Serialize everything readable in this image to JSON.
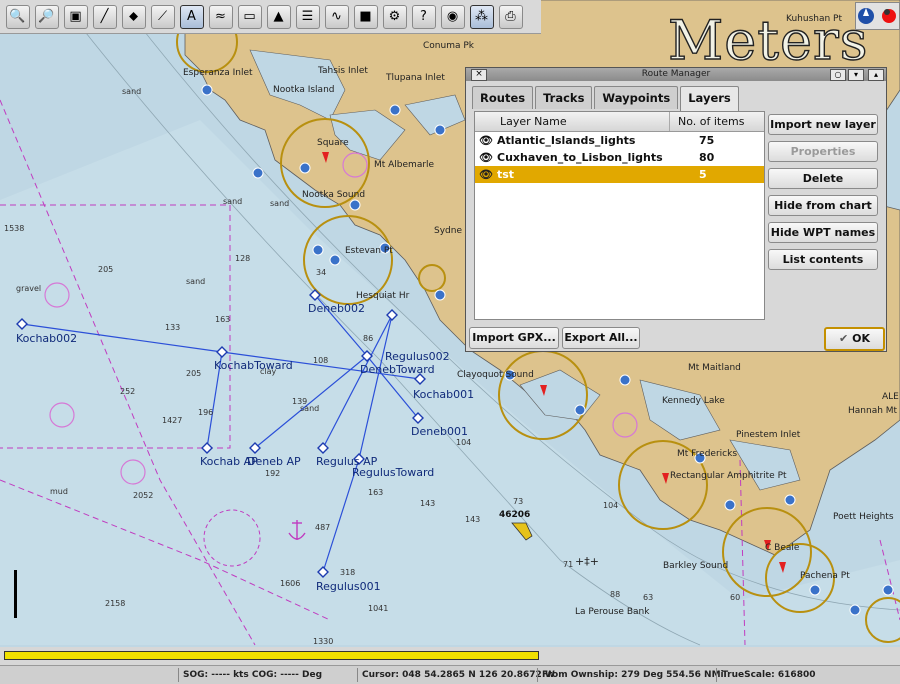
{
  "title_overlay": "Meters",
  "toolbar": {
    "buttons": [
      "zoom-in-icon",
      "zoom-out-icon",
      "layers-icon",
      "route-icon",
      "compass-rose-icon",
      "measure-icon",
      "text-tool-icon",
      "tide-icon",
      "toggle-icon",
      "ais-icon",
      "list-icon",
      "track-icon",
      "color-icon",
      "settings-icon",
      "help-icon",
      "enc-icon",
      "chart-tools-icon",
      "print-icon"
    ]
  },
  "chart": {
    "place_labels": [
      "Kuhushan Pt",
      "Conuma Pk",
      "Esperanza Inlet",
      "Tahsis Inlet",
      "Tlupana Inlet",
      "Nootka Island",
      "Square",
      "Mt Albemarle",
      "Nootka Sound",
      "Estevan Pt",
      "Hesquiat Hr",
      "Sydne",
      "Clayoquot Sound",
      "Mt Maitland",
      "Kennedy Lake",
      "Hannah Mt",
      "Pinestem Inlet",
      "Mt Fredericks",
      "Rectangular Amphitrite Pt",
      "Poett Heights",
      "C Beale",
      "Pachena Pt",
      "Barkley Sound",
      "La Perouse Bank",
      "ALE"
    ],
    "depth_labels": [
      "sand",
      "sand",
      "sand",
      "gravel",
      "sand",
      "clay",
      "sand",
      "mud",
      "1538",
      "205",
      "128",
      "163",
      "133",
      "205",
      "252",
      "196",
      "1427",
      "192",
      "139",
      "108",
      "86",
      "163",
      "143",
      "487",
      "1606",
      "2158",
      "1041",
      "1330",
      "318",
      "73",
      "88",
      "71",
      "60",
      "63",
      "104",
      "34",
      "104",
      "143",
      "2052"
    ],
    "waypoints": [
      "Kochab002",
      "KochabToward",
      "Kochab AP",
      "Deneb AP",
      "Deneb002",
      "DenebToward",
      "Deneb001",
      "Regulus002",
      "Regulus AP",
      "RegulusToward",
      "Regulus001",
      "Kochab001"
    ],
    "buoy_label": "46206"
  },
  "route_manager": {
    "title": "Route Manager",
    "window_controls": [
      "close",
      "minimize",
      "pin",
      "maximize"
    ],
    "tabs": [
      "Routes",
      "Tracks",
      "Waypoints",
      "Layers"
    ],
    "active_tab": "Layers",
    "columns": [
      "Layer Name",
      "No. of items"
    ],
    "layers": [
      {
        "name": "Atlantic_Islands_lights",
        "count": "75",
        "selected": false
      },
      {
        "name": "Cuxhaven_to_Lisbon_lights",
        "count": "80",
        "selected": false
      },
      {
        "name": "tst",
        "count": "5",
        "selected": true
      }
    ],
    "side_buttons": [
      "Import new layer",
      "Properties",
      "Delete",
      "Hide from chart",
      "Hide WPT names",
      "List contents"
    ],
    "bottom_buttons": {
      "import_gpx": "Import GPX...",
      "export_all": "Export All...",
      "ok": "OK"
    }
  },
  "status_bar": {
    "sog_cog": "SOG: ----- kts  COG: ----- Deg",
    "cursor": "Cursor: 048 54.2865 N 126 20.8672 W",
    "from_ownship": "From Ownship: 279 Deg  554.56 NMi",
    "truescale": "TrueScale:  616800"
  },
  "colors": {
    "water": "#bfd7e4",
    "land": "#ddc38d",
    "route": "#2b4fd8",
    "selection": "#e1a800"
  }
}
